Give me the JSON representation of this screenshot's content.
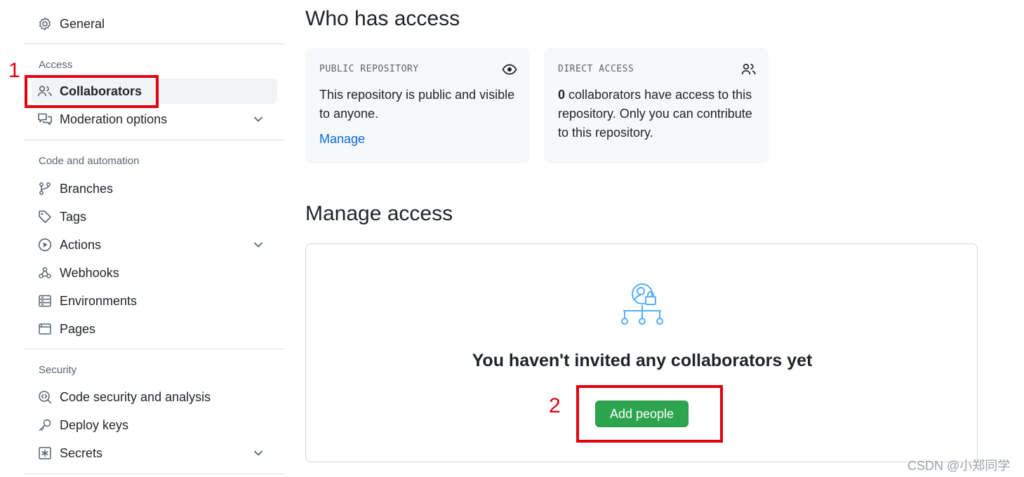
{
  "sidebar": {
    "general": "General",
    "access_title": "Access",
    "collaborators": "Collaborators",
    "moderation": "Moderation options",
    "code_title": "Code and automation",
    "branches": "Branches",
    "tags": "Tags",
    "actions": "Actions",
    "webhooks": "Webhooks",
    "environments": "Environments",
    "pages": "Pages",
    "security_title": "Security",
    "code_security": "Code security and analysis",
    "deploy_keys": "Deploy keys",
    "secrets": "Secrets"
  },
  "annotations": {
    "one": "1",
    "two": "2",
    "color": "#e3000f"
  },
  "who_has_access": {
    "heading": "Who has access",
    "public": {
      "label": "PUBLIC REPOSITORY",
      "text": "This repository is public and visible to anyone.",
      "link": "Manage"
    },
    "direct": {
      "label": "DIRECT ACCESS",
      "count": "0",
      "text": " collaborators have access to this repository. Only you can contribute to this repository."
    }
  },
  "manage_access": {
    "heading": "Manage access",
    "empty_title": "You haven't invited any collaborators yet",
    "button": "Add people"
  },
  "colors": {
    "accent_green": "#2da44e",
    "link_blue": "#0969da",
    "illustration_blue": "#54aeff"
  },
  "watermark": "CSDN @小郑同学"
}
